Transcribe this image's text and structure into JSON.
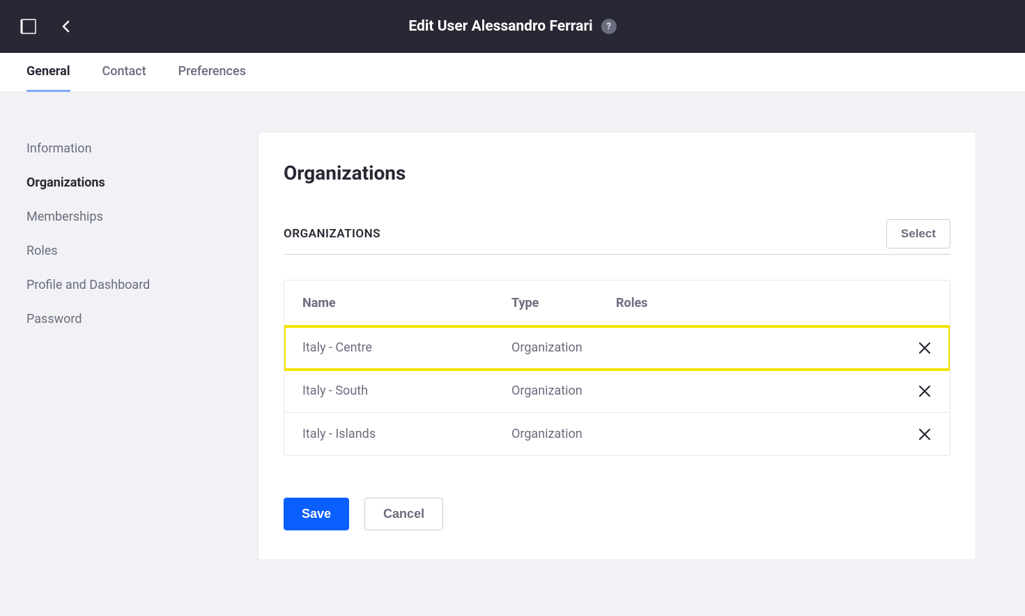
{
  "header": {
    "title": "Edit User Alessandro Ferrari"
  },
  "tabs": [
    {
      "label": "General",
      "active": true
    },
    {
      "label": "Contact",
      "active": false
    },
    {
      "label": "Preferences",
      "active": false
    }
  ],
  "sidebar": [
    {
      "label": "Information",
      "active": false
    },
    {
      "label": "Organizations",
      "active": true
    },
    {
      "label": "Memberships",
      "active": false
    },
    {
      "label": "Roles",
      "active": false
    },
    {
      "label": "Profile and Dashboard",
      "active": false
    },
    {
      "label": "Password",
      "active": false
    }
  ],
  "panel": {
    "title": "Organizations",
    "section_label": "ORGANIZATIONS",
    "select_label": "Select",
    "columns": {
      "name": "Name",
      "type": "Type",
      "roles": "Roles"
    },
    "rows": [
      {
        "name": "Italy - Centre",
        "type": "Organization",
        "roles": "",
        "highlighted": true
      },
      {
        "name": "Italy - South",
        "type": "Organization",
        "roles": "",
        "highlighted": false
      },
      {
        "name": "Italy - Islands",
        "type": "Organization",
        "roles": "",
        "highlighted": false
      }
    ]
  },
  "actions": {
    "save": "Save",
    "cancel": "Cancel"
  }
}
